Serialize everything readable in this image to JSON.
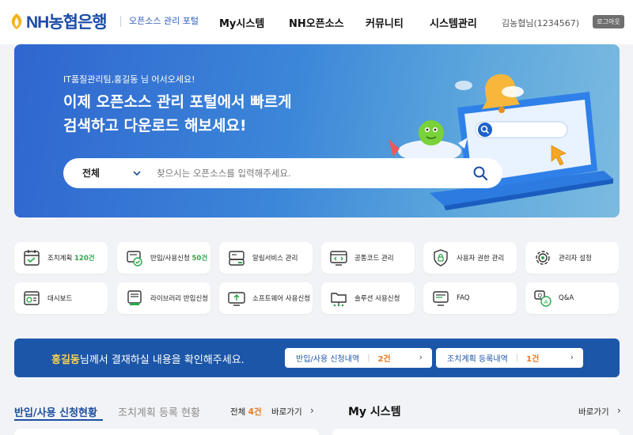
{
  "header": {
    "logo_text": "NH농협은행",
    "portal_name": "오픈소스 관리 포털",
    "nav": [
      {
        "label": "My시스템"
      },
      {
        "label": "NH오픈소스"
      },
      {
        "label": "커뮤니티"
      },
      {
        "label": "시스템관리"
      }
    ],
    "user": "김농협님(1234567)",
    "logout_label": "로그아웃",
    "brand_color": "#1e4da8"
  },
  "hero": {
    "greeting": "IT품질관리팀,홍길동 님 어서오세요!",
    "title_line1": "이제 오픈소스 관리 포털에서 빠르게",
    "title_line2": "검색하고 다운로드 해보세요!",
    "search": {
      "category": "전체",
      "placeholder": "찾으시는 오픈소스를 입력해주세요."
    }
  },
  "quick_menu": [
    {
      "label": "조치계획 ",
      "count": "120건",
      "icon": "calendar-icon"
    },
    {
      "label": "반입/사용신청 ",
      "count": "50건",
      "icon": "request-check-icon"
    },
    {
      "label": "알림서비스 관리",
      "count": "",
      "icon": "notification-service-icon"
    },
    {
      "label": "공통코드 관리",
      "count": "",
      "icon": "code-window-icon"
    },
    {
      "label": "사용자 권한 관리",
      "count": "",
      "icon": "lock-icon"
    },
    {
      "label": "관리자 설정",
      "count": "",
      "icon": "gear-icon"
    },
    {
      "label": "대시보드",
      "count": "",
      "icon": "dashboard-icon"
    },
    {
      "label": "라이브러리 반입신청",
      "count": "",
      "icon": "library-icon"
    },
    {
      "label": "소프트웨어 사용신청",
      "count": "",
      "icon": "software-upload-icon"
    },
    {
      "label": "솔루션 사용신청",
      "count": "",
      "icon": "folder-network-icon"
    },
    {
      "label": "FAQ",
      "count": "",
      "icon": "faq-icon"
    },
    {
      "label": "Q&A",
      "count": "",
      "icon": "qna-icon"
    }
  ],
  "approval": {
    "name": "홍길동",
    "message": "님께서 결재하실 내용을 확인해주세요.",
    "buttons": [
      {
        "label": "반입/사용 신청내역",
        "separator": "|",
        "count": "2건",
        "arrow": "›"
      },
      {
        "label": "조치계획 등록내역",
        "separator": "|",
        "count": "1건",
        "arrow": "›"
      }
    ]
  },
  "bottom": {
    "tab_active": "반입/사용 신청현황",
    "tab_inactive": "조치계획 등록 현황",
    "total_label": "전체 ",
    "total_count": "4건",
    "goto_label": "바로가기",
    "goto_arrow": "›",
    "my_system_title": "My 시스템",
    "my_system_goto": "바로가기",
    "my_system_arrow": "›"
  }
}
